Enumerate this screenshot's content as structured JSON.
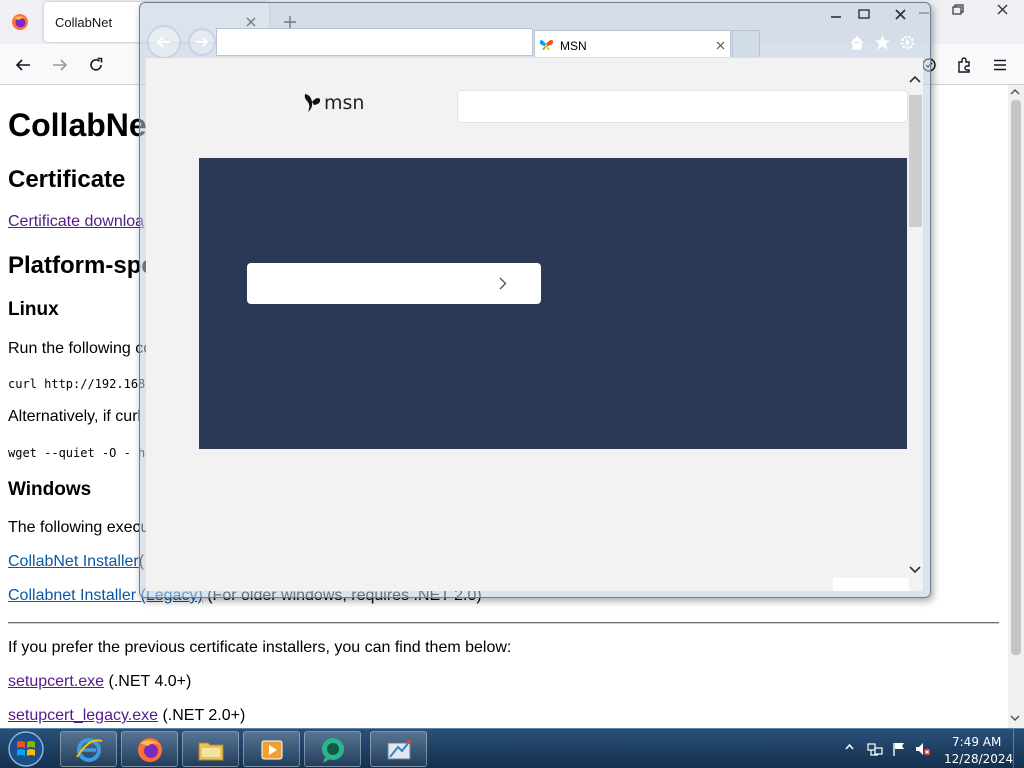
{
  "firefox": {
    "tab_title": "CollabNet",
    "content": {
      "h1": "CollabNe",
      "h2_certificate": "Certificate",
      "certificate_link": "Certificate downloa",
      "h2_platform": "Platform-spe",
      "h3_linux": "Linux",
      "linux_text": "Run the following co",
      "curl_code": "curl http://192.168.",
      "alt_text": "Alternatively, if curl",
      "wget_code": "wget --quiet -O - ht",
      "h3_windows": "Windows",
      "windows_text": "The following execu",
      "installer_link": "CollabNet Installer",
      "installer_suffix": "(",
      "legacy_link": "Collabnet Installer (Legacy)",
      "legacy_suffix": " (For older windows, requires .NET 2.0)",
      "prev_text": "If you prefer the previous certificate installers, you can find them below:",
      "setupcert_link": "setupcert.exe",
      "setupcert_suffix": " (.NET 4.0+)",
      "setupcert_legacy_link": "setupcert_legacy.exe",
      "setupcert_legacy_suffix": " (.NET 2.0+)"
    }
  },
  "ie": {
    "tab_title": "MSN",
    "msn": {
      "logo_text": "msn"
    }
  },
  "taskbar": {
    "apps": [
      "internet-explorer",
      "firefox",
      "file-explorer",
      "media-player",
      "remote-app",
      "network-app"
    ],
    "clock_time": "7:49 AM",
    "clock_date": "12/28/2024"
  },
  "colors": {
    "msn_banner": "#2b3856",
    "link": "#0b57a6",
    "visited_link": "#551a8b"
  }
}
